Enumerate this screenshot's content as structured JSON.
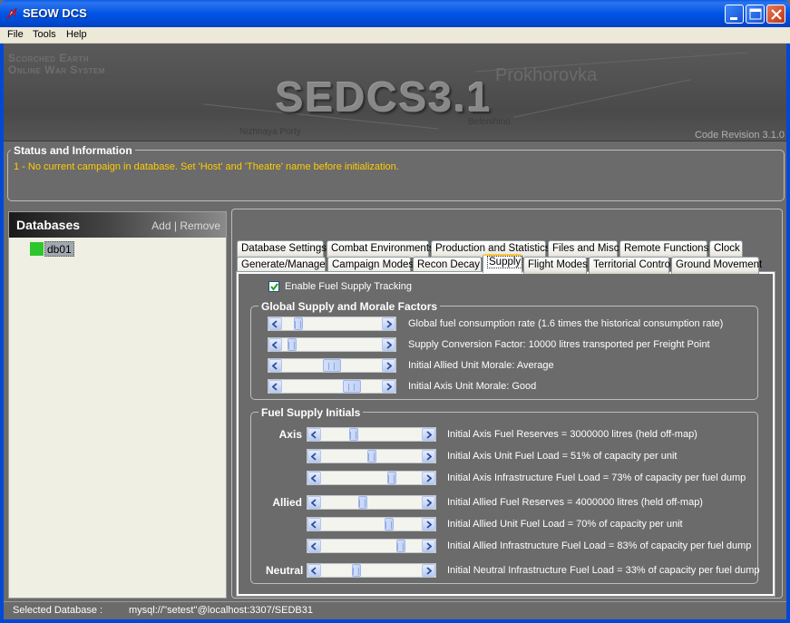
{
  "window": {
    "title": "SEOW DCS",
    "controls": [
      "minimize",
      "maximize",
      "close"
    ]
  },
  "menu": [
    "File",
    "Tools",
    "Help"
  ],
  "banner": {
    "brand_line1": "Scorched Earth",
    "brand_line2": "Online War System",
    "title": "SEDCS3.1",
    "map_labels": [
      "Prokhorovka",
      "Nizhnaya Porty",
      "Belenihino"
    ],
    "code_revision": "Code Revision 3.1.0"
  },
  "status": {
    "title": "Status and Information",
    "message": "1 - No current campaign in database. Set 'Host' and 'Theatre' name before initialization."
  },
  "databases": {
    "title": "Databases",
    "add": "Add",
    "separator": "|",
    "remove": "Remove",
    "items": [
      {
        "name": "db01",
        "color": "#2ec52e"
      }
    ]
  },
  "tabs": {
    "row1": [
      "Database Settings",
      "Combat Environments",
      "Production and Statistics",
      "Files and Misc",
      "Remote Functions",
      "Clock"
    ],
    "row2": [
      "Generate/Manage",
      "Campaign Modes",
      "Recon Decay",
      "Supply",
      "Flight Modes",
      "Territorial Control",
      "Ground Movement"
    ],
    "active": "Supply"
  },
  "supply": {
    "enable_label": "Enable Fuel Supply Tracking",
    "enable_checked": true,
    "global_group": {
      "title": "Global Supply and Morale Factors",
      "rows": [
        {
          "label": "Global fuel consumption rate (1.6 times the historical consumption rate)",
          "value": 0.12
        },
        {
          "label": "Supply Conversion Factor: 10000 litres transported per Freight Point",
          "value": 0.05
        },
        {
          "label": "Initial Allied Unit Morale: Average",
          "value": 0.5
        },
        {
          "label": "Initial Axis Unit Morale: Good",
          "value": 0.75
        }
      ]
    },
    "initials_group": {
      "title": "Fuel Supply Initials",
      "sides": [
        {
          "side": "Axis",
          "rows": [
            {
              "label": "Initial Axis Fuel Reserves = 3000000 litres (held off-map)",
              "value": 0.3
            },
            {
              "label": "Initial Axis Unit Fuel Load = 51% of capacity per unit",
              "value": 0.51
            },
            {
              "label": "Initial Axis Infrastructure Fuel Load = 73% of capacity per fuel dump",
              "value": 0.73
            }
          ]
        },
        {
          "side": "Allied",
          "rows": [
            {
              "label": "Initial Allied Fuel Reserves = 4000000 litres (held off-map)",
              "value": 0.4
            },
            {
              "label": "Initial Allied Unit Fuel Load = 70% of capacity per unit",
              "value": 0.7
            },
            {
              "label": "Initial Allied Infrastructure Fuel Load = 83% of capacity per fuel dump",
              "value": 0.83
            }
          ]
        },
        {
          "side": "Neutral",
          "rows": [
            {
              "label": "Initial Neutral Infrastructure Fuel Load = 33% of capacity per fuel dump",
              "value": 0.33
            }
          ]
        }
      ]
    }
  },
  "statusbar": {
    "label": "Selected Database :",
    "value": "mysql://''setest''@localhost:3307/SEDB31"
  }
}
